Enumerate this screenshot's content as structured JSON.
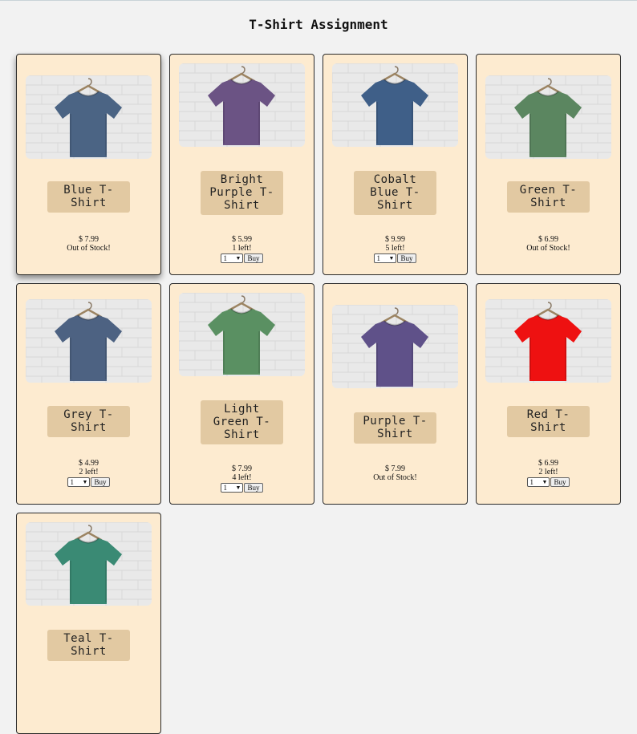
{
  "page_title": "T-Shirt Assignment",
  "products": [
    {
      "name": "Blue T-Shirt",
      "price": "$ 7.99",
      "stock": "Out of Stock!",
      "available": false,
      "color": "#4b6484",
      "raised": true
    },
    {
      "name": "Bright Purple T-Shirt",
      "price": "$ 5.99",
      "stock": "1 left!",
      "available": true,
      "qty": "1",
      "buy": "Buy",
      "color": "#6b5384",
      "raised": false
    },
    {
      "name": "Cobalt Blue T-Shirt",
      "price": "$ 9.99",
      "stock": "5 left!",
      "available": true,
      "qty": "1",
      "buy": "Buy",
      "color": "#3f5f88",
      "raised": false
    },
    {
      "name": "Green T-Shirt",
      "price": "$ 6.99",
      "stock": "Out of Stock!",
      "available": false,
      "color": "#5b8660",
      "raised": false
    },
    {
      "name": "Grey T-Shirt",
      "price": "$ 4.99",
      "stock": "2 left!",
      "available": true,
      "qty": "1",
      "buy": "Buy",
      "color": "#4d6282",
      "raised": false
    },
    {
      "name": "Light Green T-Shirt",
      "price": "$ 7.99",
      "stock": "4 left!",
      "available": true,
      "qty": "1",
      "buy": "Buy",
      "color": "#5a9062",
      "raised": false
    },
    {
      "name": "Purple T-Shirt",
      "price": "$ 7.99",
      "stock": "Out of Stock!",
      "available": false,
      "color": "#5f5189",
      "raised": false
    },
    {
      "name": "Red T-Shirt",
      "price": "$ 6.99",
      "stock": "2 left!",
      "available": true,
      "qty": "1",
      "buy": "Buy",
      "color": "#ee1111",
      "raised": false
    },
    {
      "name": "Teal T-Shirt",
      "color": "#3a8a74",
      "raised": false
    }
  ]
}
